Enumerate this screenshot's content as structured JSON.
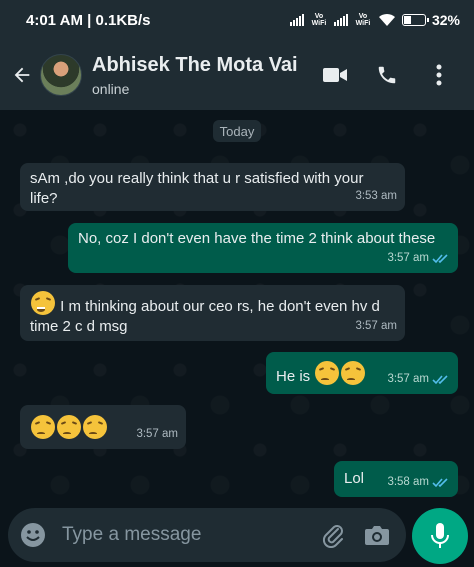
{
  "status_bar": {
    "time_speed": "4:01 AM | 0.1KB/s",
    "vowifi_1": "Vo WiFi",
    "vowifi_2": "Vo WiFi",
    "battery": "32%",
    "battery_level": 0.32
  },
  "header": {
    "contact_name": "Abhisek The Mota Vai",
    "contact_status": "online",
    "icons": [
      "back-arrow-icon",
      "video-call-icon",
      "phone-icon",
      "more-vert-icon"
    ]
  },
  "chat": {
    "date_chip": "Today",
    "messages": [
      {
        "dir": "in",
        "text": "sAm ,do you really think that u r satisfied with your life?",
        "time": "3:53 am"
      },
      {
        "dir": "out",
        "text": "No, coz I don't even have the time 2 think about these",
        "time": "3:57 am",
        "ticks": "read"
      },
      {
        "dir": "in",
        "text": "I m thinking about our ceo rs, he don't even hv d time 2 c d msg",
        "emoji": "grinning-squinting-face",
        "time": "3:57 am"
      },
      {
        "dir": "out",
        "text": "He is",
        "emoji": "sad-face x2",
        "time": "3:57 am",
        "ticks": "read"
      },
      {
        "dir": "in",
        "emoji": "sad-face x3",
        "time": "3:57 am"
      },
      {
        "dir": "out",
        "text": "Lol",
        "time": "3:58 am",
        "ticks": "read"
      }
    ]
  },
  "composer": {
    "placeholder": "Type a message",
    "icons": [
      "emoji-icon",
      "attach-icon",
      "camera-icon",
      "mic-icon"
    ]
  },
  "colors": {
    "background": "#0b141a",
    "header": "#1f2c33",
    "incoming_bubble": "#202c33",
    "outgoing_bubble": "#005c4b",
    "accent": "#00a884",
    "read_tick": "#53bdeb"
  }
}
